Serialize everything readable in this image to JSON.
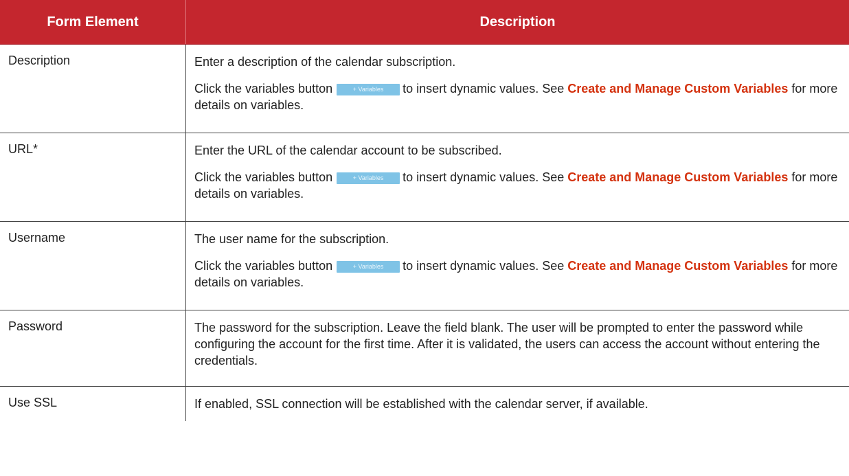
{
  "header": {
    "col1": "Form Element",
    "col2": "Description"
  },
  "variables_button_label": "+ Variables",
  "rows": [
    {
      "element": "Description",
      "p1": "Enter a description of the calendar subscription.",
      "p2_before": "Click the variables button",
      "p2_after": "to insert dynamic values. See",
      "link": "Create and Manage Custom Variables",
      "p2_end": "for more details on variables."
    },
    {
      "element": "URL*",
      "p1": "Enter the URL of the calendar account to be subscribed.",
      "p2_before": "Click the variables button",
      "p2_after": "to insert dynamic values. See",
      "link": "Create and Manage Custom Variables",
      "p2_end": "for more details on variables."
    },
    {
      "element": "Username",
      "p1": "The user name for the subscription.",
      "p2_before": "Click the variables button",
      "p2_after": "to insert dynamic values. See",
      "link": "Create and Manage Custom Variables",
      "p2_end": "for more details on variables."
    },
    {
      "element": "Password",
      "p1": "The password for the subscription. Leave the field blank. The user will be prompted to enter the password while configuring the account for the first time. After it is validated, the users can access the account without entering the credentials."
    },
    {
      "element": "Use SSL",
      "p1": "If enabled, SSL connection will be established with the calendar server, if available."
    }
  ]
}
